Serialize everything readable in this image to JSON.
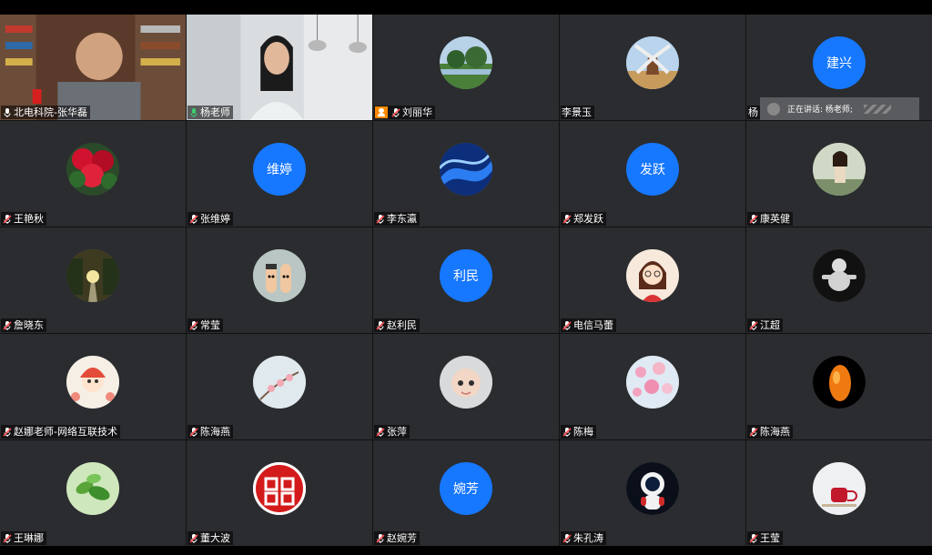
{
  "window": {
    "title": ""
  },
  "speaking_indicator": {
    "text": "正在讲话: 杨老师;"
  },
  "participants": [
    {
      "name": "北电科院-张华磊",
      "video": true,
      "mic": "on",
      "avatar": "video-man"
    },
    {
      "name": "杨老师",
      "video": true,
      "mic": "on-green",
      "avatar": "video-woman"
    },
    {
      "name": "刘丽华",
      "video": false,
      "mic": "muted",
      "camera_badge": true,
      "avatar": "photo-park"
    },
    {
      "name": "李景玉",
      "video": false,
      "mic": "none",
      "avatar": "photo-windmill"
    },
    {
      "name": "杨",
      "video": false,
      "mic": "none",
      "avatar_text": "建兴"
    },
    {
      "name": "王艳秋",
      "video": false,
      "mic": "muted",
      "avatar": "photo-roses"
    },
    {
      "name": "张维婷",
      "video": false,
      "mic": "muted",
      "avatar_text": "维婷"
    },
    {
      "name": "李东瀛",
      "video": false,
      "mic": "muted",
      "avatar": "photo-blue-wave"
    },
    {
      "name": "郑发跃",
      "video": false,
      "mic": "muted",
      "avatar_text": "发跃"
    },
    {
      "name": "康英健",
      "video": false,
      "mic": "muted",
      "avatar": "photo-woman"
    },
    {
      "name": "詹晓东",
      "video": false,
      "mic": "muted",
      "avatar": "photo-road"
    },
    {
      "name": "常莹",
      "video": false,
      "mic": "muted",
      "avatar": "photo-fingers"
    },
    {
      "name": "赵利民",
      "video": false,
      "mic": "muted",
      "avatar_text": "利民"
    },
    {
      "name": "电信马蕾",
      "video": false,
      "mic": "muted",
      "avatar": "cartoon-girl"
    },
    {
      "name": "江超",
      "video": false,
      "mic": "muted",
      "avatar": "statue-baby"
    },
    {
      "name": "赵娜老师-网络互联技术",
      "video": false,
      "mic": "muted",
      "avatar": "cartoon-child"
    },
    {
      "name": "陈海燕",
      "video": false,
      "mic": "muted",
      "avatar": "photo-branch"
    },
    {
      "name": "张萍",
      "video": false,
      "mic": "muted",
      "avatar": "photo-baby"
    },
    {
      "name": "陈梅",
      "video": false,
      "mic": "muted",
      "avatar": "photo-blossom"
    },
    {
      "name": "陈海燕",
      "video": false,
      "mic": "muted",
      "avatar": "photo-amber"
    },
    {
      "name": "王琳娜",
      "video": false,
      "mic": "muted",
      "avatar": "photo-leaves"
    },
    {
      "name": "董大波",
      "video": false,
      "mic": "muted",
      "avatar": "seal-red"
    },
    {
      "name": "赵婉芳",
      "video": false,
      "mic": "muted",
      "avatar_text": "婉芳"
    },
    {
      "name": "朱孔涛",
      "video": false,
      "mic": "muted",
      "avatar": "astronaut"
    },
    {
      "name": "王莹",
      "video": false,
      "mic": "muted",
      "avatar": "photo-cup"
    }
  ],
  "colors": {
    "accent": "#1677ff",
    "tile_bg": "#2a2c2f",
    "camera_badge": "#ff8a00"
  }
}
